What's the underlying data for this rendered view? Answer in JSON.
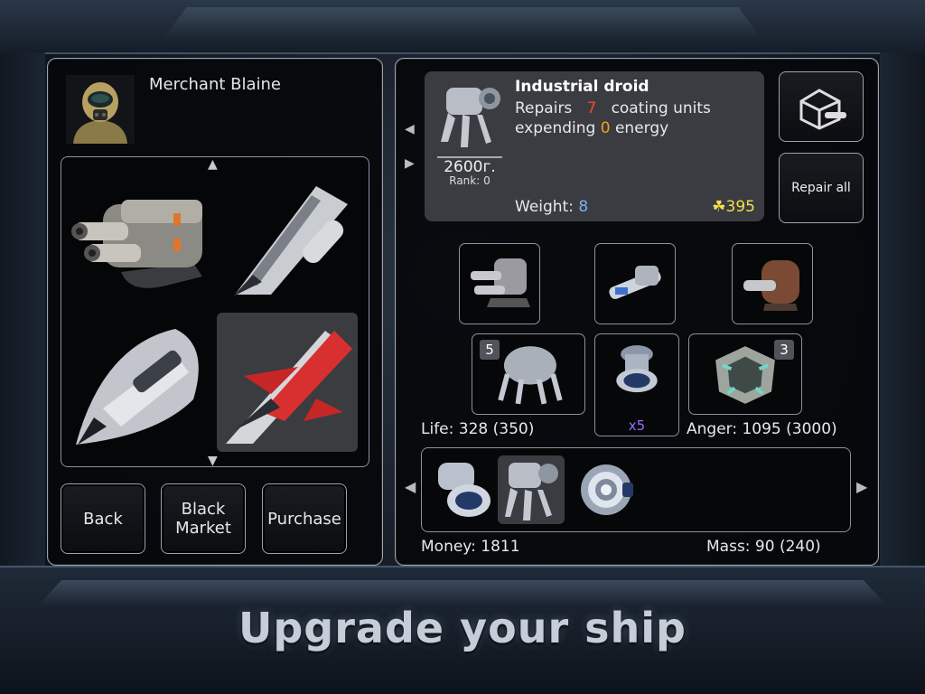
{
  "merchant": {
    "name": "Merchant Blaine"
  },
  "buttons": {
    "back": "Back",
    "black_market": "Black\nMarket",
    "purchase": "Purchase",
    "repair_all": "Repair all"
  },
  "item": {
    "title": "Industrial droid",
    "desc_prefix": "Repairs",
    "repair_units": "7",
    "desc_mid": "coating units expending",
    "energy": "0",
    "desc_suffix": "energy",
    "price": "2600г.",
    "rank": "Rank: 0",
    "weight_label": "Weight:",
    "weight_value": "8",
    "cost": "395"
  },
  "slots": {
    "droid_count": "5",
    "module_stack": "x5",
    "armor_count": "3"
  },
  "stats": {
    "life": "Life: 328 (350)",
    "anger": "Anger: 1095 (3000)",
    "money": "Money: 1811",
    "mass": "Mass: 90 (240)"
  },
  "tagline": "Upgrade your ship",
  "colors": {
    "accent_red": "#f04a2a",
    "accent_orange": "#f0a21a",
    "weight_blue": "#7db0e8",
    "cost_yellow": "#f4e04a",
    "stack_purple": "#9b6bff"
  },
  "icons": [
    "merchant-portrait-icon",
    "twin-cannon-icon",
    "fighter-ship-icon",
    "shuttle-ship-icon",
    "red-ship-icon",
    "droid-icon",
    "repair-icon",
    "railgun-icon",
    "leather-cannon-icon",
    "energy-module-icon",
    "armor-plate-icon",
    "shield-disc-icon"
  ]
}
